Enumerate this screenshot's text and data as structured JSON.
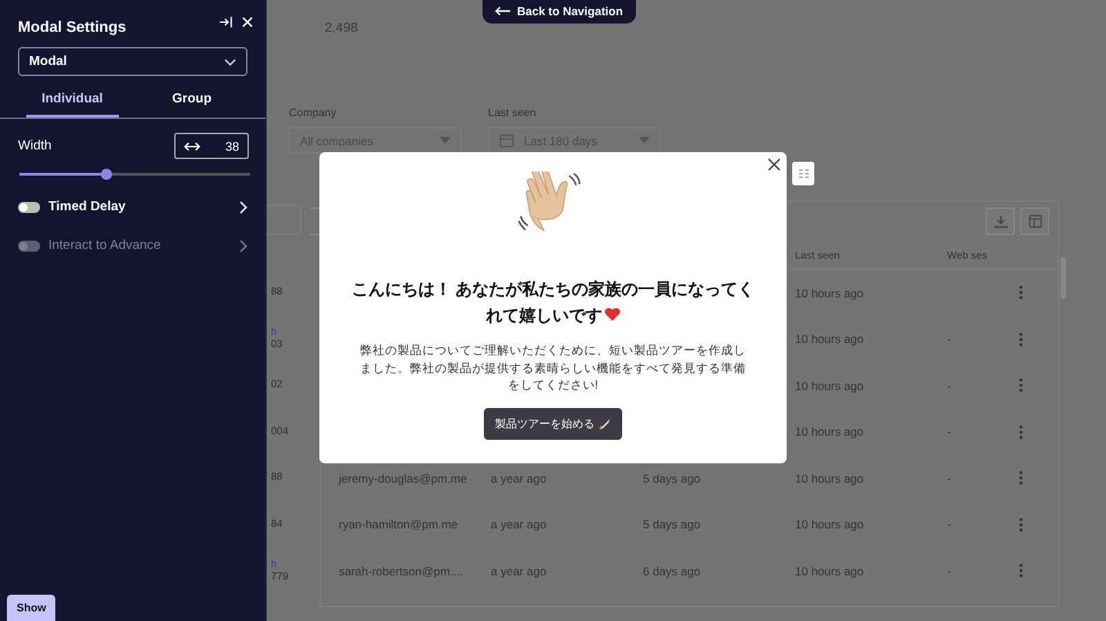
{
  "sidebar": {
    "title": "Modal Settings",
    "dropdown": {
      "value": "Modal"
    },
    "tabs": [
      {
        "label": "Individual",
        "selected": true
      },
      {
        "label": "Group",
        "selected": false
      }
    ],
    "width": {
      "label": "Width",
      "value": "38",
      "level": 0.38
    },
    "settings": [
      {
        "label": "Timed Delay",
        "on": false,
        "disabled": false
      },
      {
        "label": "Interact to Advance",
        "on": false,
        "disabled": true
      }
    ],
    "show_button": "Show"
  },
  "back_button": "Back to Navigation",
  "page": {
    "count": "2,498",
    "filters": [
      {
        "kind": "select",
        "label": "Company",
        "value": "All companies"
      },
      {
        "kind": "date",
        "label": "Last seen",
        "value": "Last 180 days"
      }
    ],
    "table": {
      "header": [
        "Last seen",
        "Web ses"
      ],
      "rows": [
        {
          "side": "88",
          "last_seen": "10 hours ago"
        },
        {
          "side_link": "h",
          "side": "03",
          "last_seen": "10 hours ago",
          "web": "-"
        },
        {
          "side": "02",
          "last_seen": "10 hours ago",
          "web": "-"
        },
        {
          "side": "004",
          "last_seen": "10 hours ago",
          "web": "-"
        },
        {
          "side": "88",
          "email": "jeremy-douglas@pm.me",
          "created": "a year ago",
          "seen": "5 days ago",
          "last_seen": "10 hours ago",
          "web": "-"
        },
        {
          "side": "84",
          "email": "ryan-hamilton@pm.me",
          "created": "a year ago",
          "seen": "5 days ago",
          "last_seen": "10 hours ago",
          "web": "-"
        },
        {
          "side_link": "h",
          "side": "779",
          "email": "sarah-robertson@pm....",
          "created": "a year ago",
          "seen": "6 days ago",
          "last_seen": "10 hours ago",
          "web": "-"
        }
      ]
    }
  },
  "modal": {
    "heading": "こんにちは！ あなたが私たちの家族の一員になってくれて嬉しいです",
    "body": "弊社の製品についてご理解いただくために、短い製品ツアーを作成しました。弊社の製品が提供する素晴らしい機能をすべて発見する準備をしてください!",
    "button": "製品ツアーを始める"
  }
}
